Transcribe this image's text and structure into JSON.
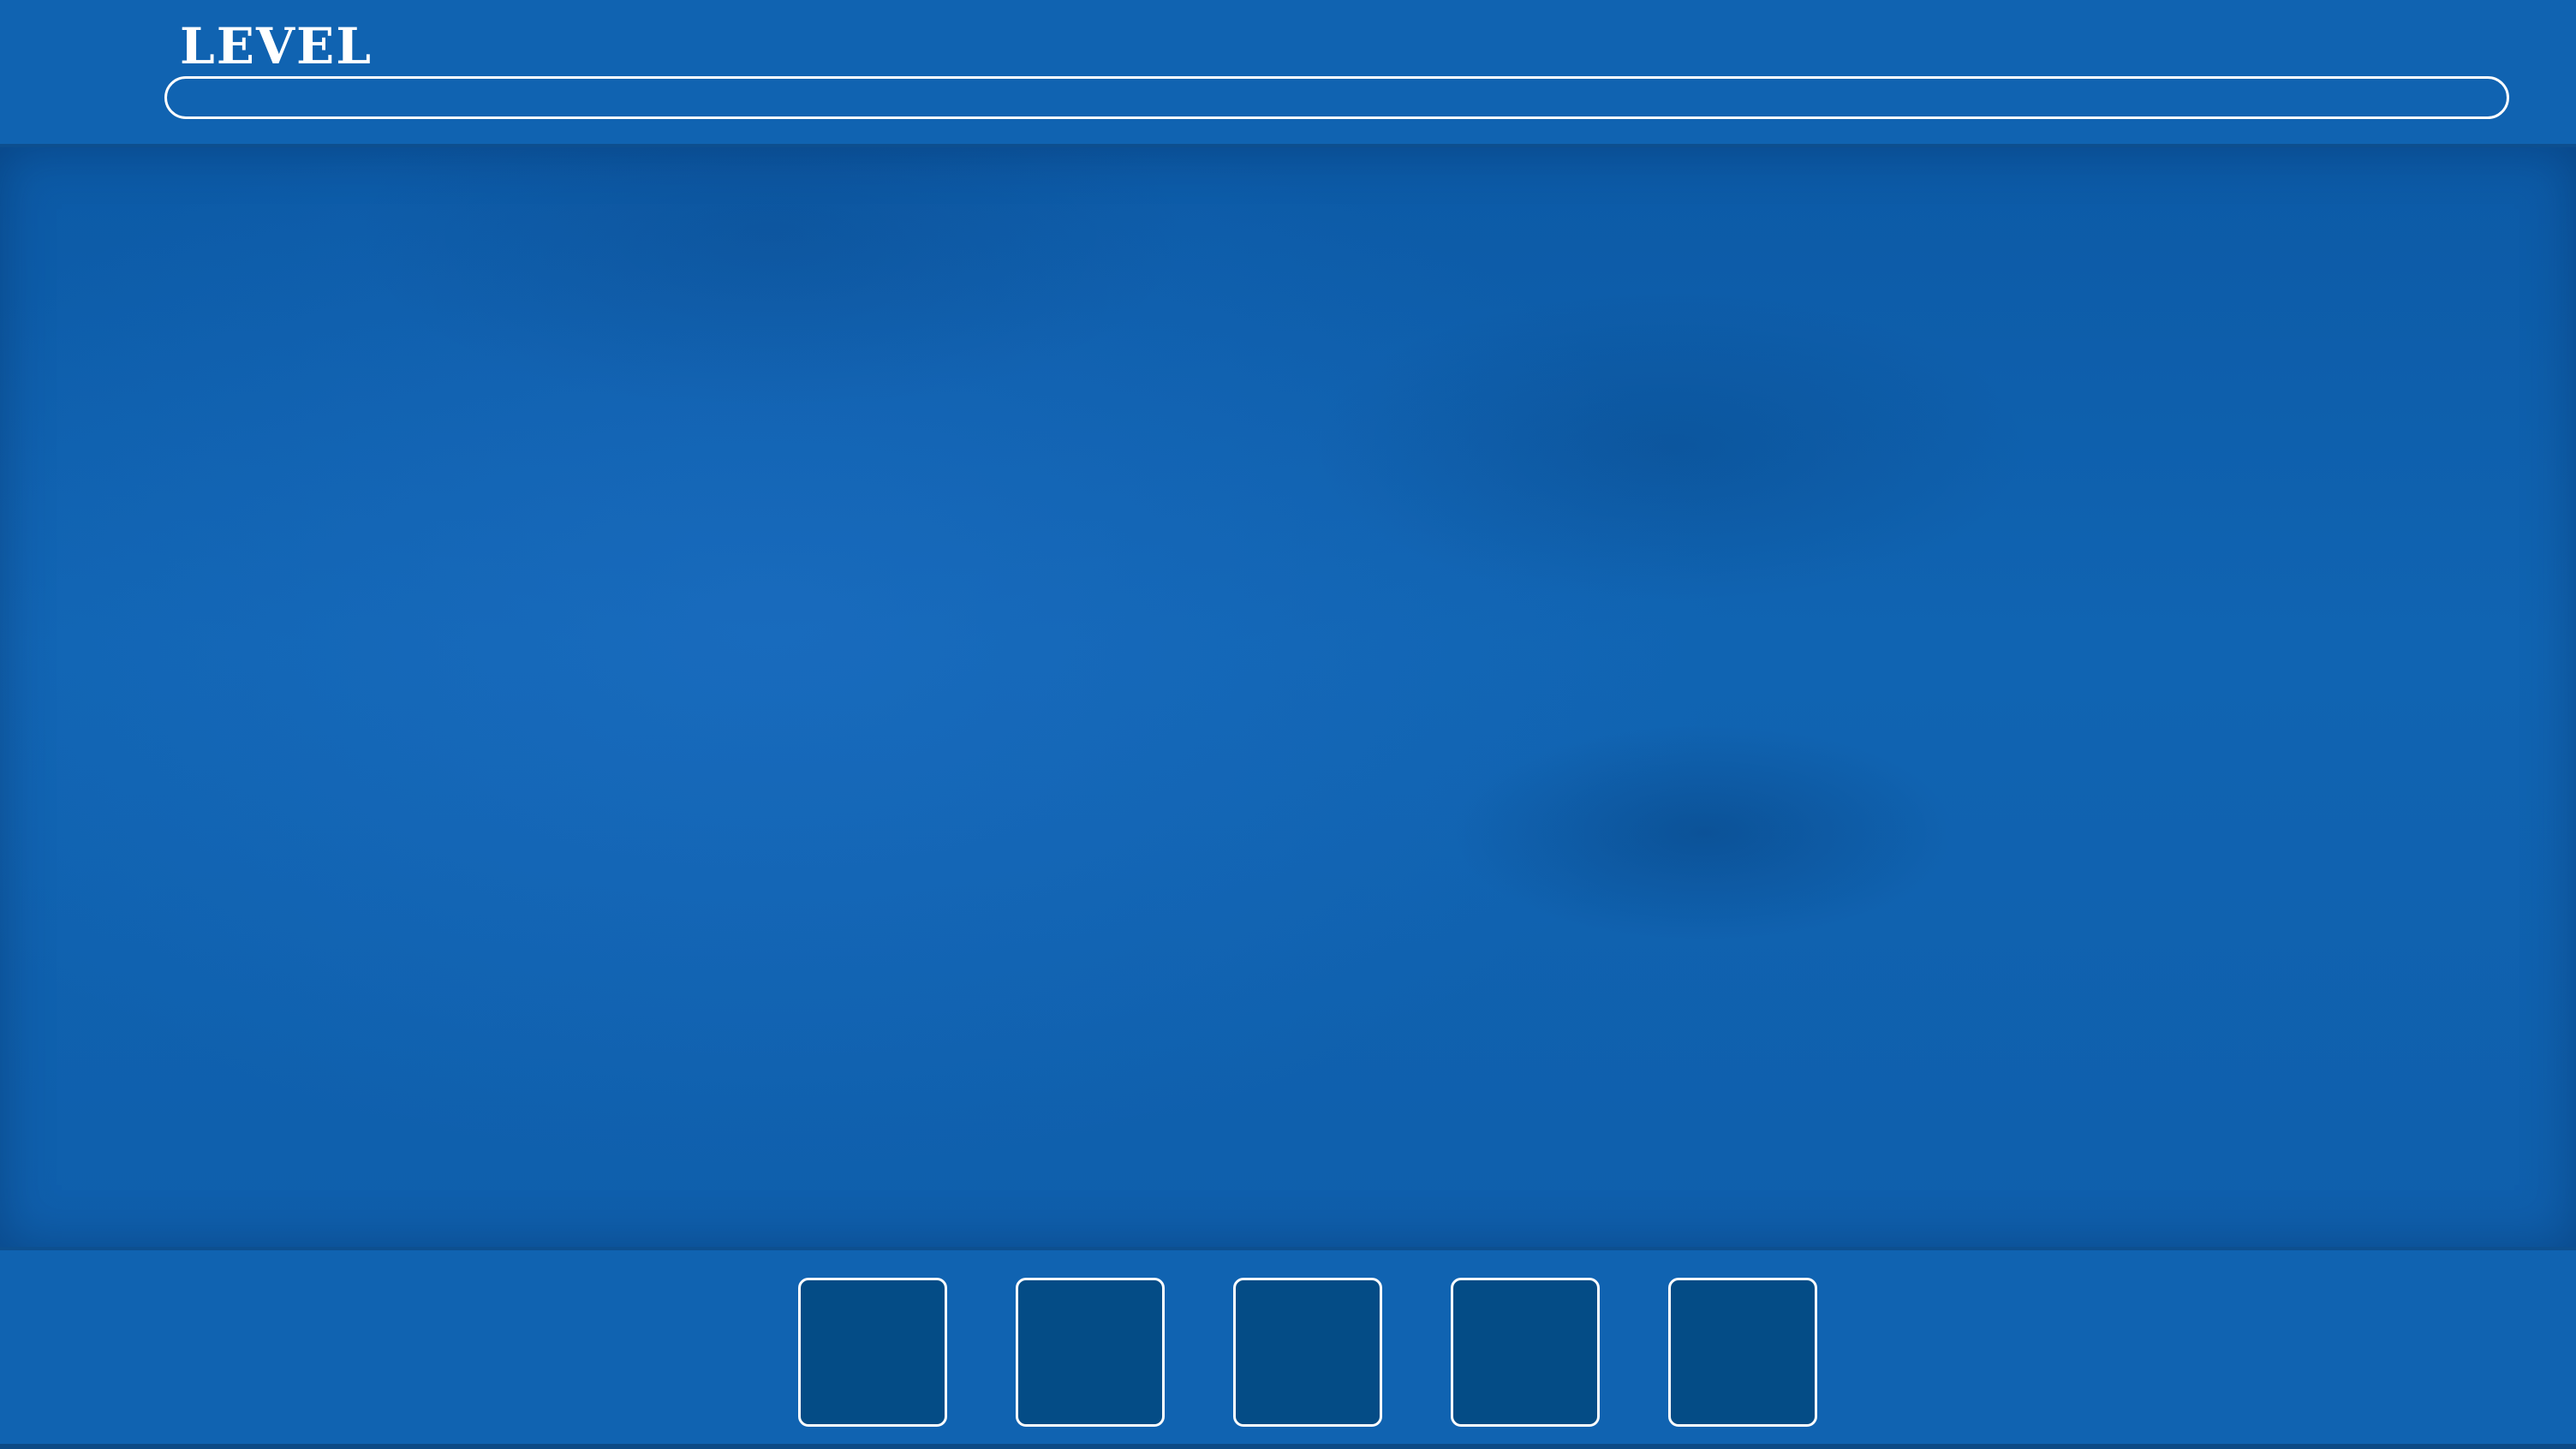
{
  "header": {
    "level_label": "LEVEL",
    "level_progress": 0.0
  },
  "tray": {
    "slots": [
      {
        "content": ""
      },
      {
        "content": ""
      },
      {
        "content": ""
      },
      {
        "content": ""
      },
      {
        "content": ""
      }
    ]
  },
  "colors": {
    "background": "#1063b1",
    "board": "#0e5eab",
    "slot_fill": "#044c86",
    "outline": "#ffffff"
  }
}
